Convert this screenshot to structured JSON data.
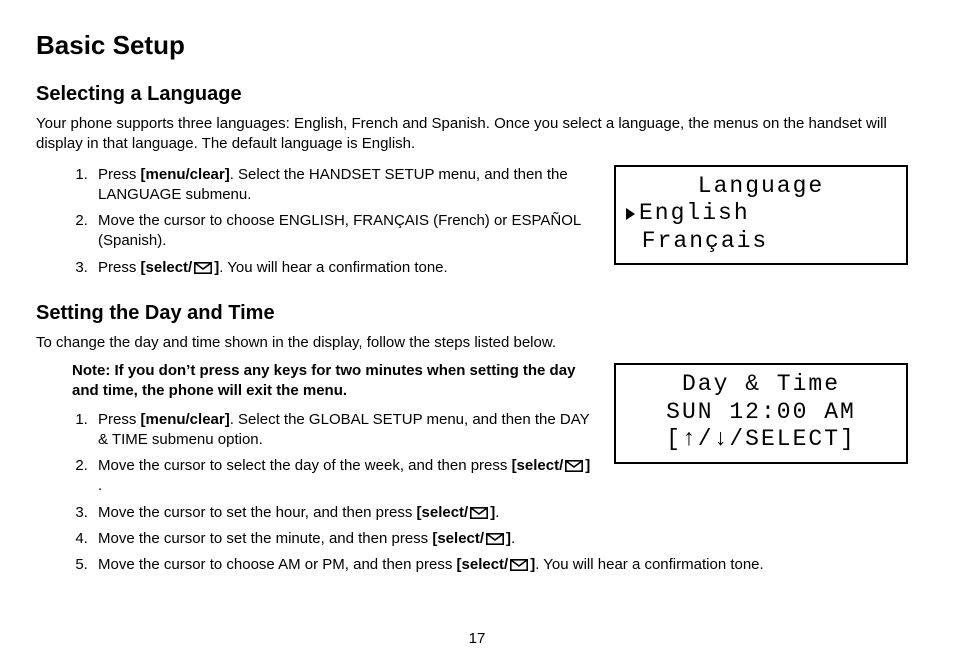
{
  "page_title": "Basic Setup",
  "page_number": "17",
  "select_key": {
    "open": "[select/",
    "close": "]"
  },
  "menu_clear_key": "[menu/clear]",
  "section1": {
    "title": "Selecting a Language",
    "intro": "Your phone supports three languages: English, French and Spanish. Once you select a language, the menus on the handset will display in that language. The default language is English.",
    "steps": [
      {
        "pre": "Press ",
        "key": "[menu/clear]",
        "post": ". Select the HANDSET SETUP menu, and then the LANGUAGE submenu."
      },
      {
        "pre": "Move the cursor to choose ENGLISH, FRANÇAIS (French) or ESPAÑOL (Spanish).",
        "key": "",
        "post": ""
      },
      {
        "pre": "Press ",
        "select_key": true,
        "post": ". You will hear a confirmation tone."
      }
    ],
    "lcd": {
      "line1": "Language",
      "line2": "English",
      "line3": " Français"
    }
  },
  "section2": {
    "title": "Setting the Day and Time",
    "intro": "To change the day and time shown in the display, follow the steps listed below.",
    "note": "Note: If you don’t press any keys for two minutes when setting the day and time, the phone will exit the menu.",
    "steps_a": [
      {
        "pre": "Press ",
        "key": "[menu/clear]",
        "post": ". Select the GLOBAL SETUP menu, and then the DAY & TIME submenu option."
      },
      {
        "pre": "Move the cursor to select the day of the week, and then press ",
        "select_key": true,
        "post": "."
      }
    ],
    "steps_b": [
      {
        "pre": "Move the cursor to set the hour, and then press ",
        "select_key": true,
        "post": "."
      },
      {
        "pre": "Move the cursor to set the minute, and then press ",
        "select_key": true,
        "post": "."
      },
      {
        "pre": "Move the cursor to choose AM or PM, and then press ",
        "select_key": true,
        "post": ". You will hear a confirmation tone."
      }
    ],
    "lcd": {
      "line1": "Day & Time",
      "line2": "SUN 12:00 AM",
      "line3": "[↑/↓/SELECT]"
    }
  }
}
